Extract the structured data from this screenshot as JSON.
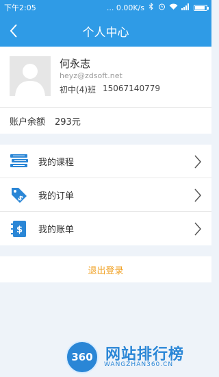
{
  "statusbar": {
    "time": "下午2:05",
    "speed": "... 0.00K/s",
    "icons": [
      "bluetooth-icon",
      "alarm-icon",
      "wifi-icon",
      "signal-icon",
      "battery-icon"
    ]
  },
  "header": {
    "title": "个人中心",
    "back_icon": "chevron-left-icon",
    "color": "#2f9be6"
  },
  "profile": {
    "name": "何永志",
    "email": "heyz@zdsoft.net",
    "class": "初中(4)班",
    "phone": "15067140779",
    "avatar_icon": "user-avatar-icon"
  },
  "balance": {
    "label": "账户余额",
    "value": "293元"
  },
  "menu": {
    "items": [
      {
        "label": "我的课程",
        "icon": "books-icon"
      },
      {
        "label": "我的订单",
        "icon": "price-tag-icon"
      },
      {
        "label": "我的账单",
        "icon": "bill-notebook-icon"
      }
    ]
  },
  "logout": {
    "label": "退出登录",
    "color": "#f0a022"
  },
  "watermark": {
    "logo": "360",
    "text": "网站排行榜",
    "sub": "WANGZHAN360.CN"
  }
}
